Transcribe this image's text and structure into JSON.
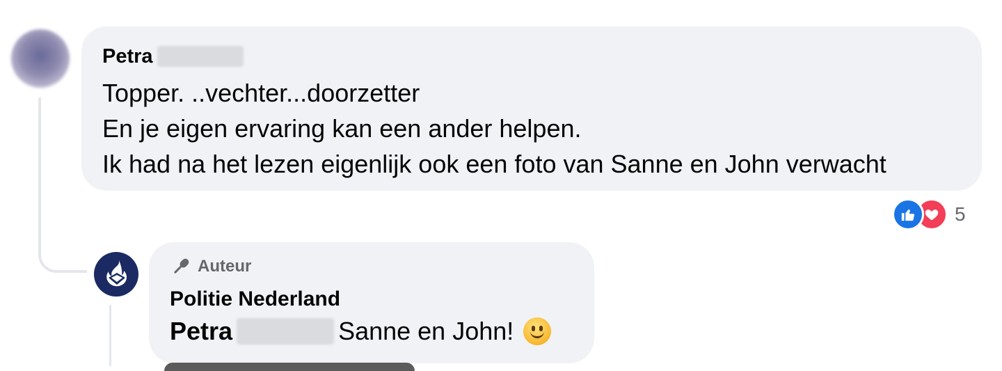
{
  "comment": {
    "author_first_name": "Petra",
    "lines": [
      "Topper. ..vechter...doorzetter",
      "En je eigen ervaring kan een ander helpen.",
      "Ik had na het lezen eigenlijk ook een foto van Sanne en John verwacht"
    ],
    "reactions": {
      "icons": [
        "like-icon",
        "love-icon"
      ],
      "count": "5",
      "colors": {
        "like": "#1b74e4",
        "love": "#f33e58"
      }
    }
  },
  "reply": {
    "badge_label": "Auteur",
    "badge_icon": "microphone-icon",
    "author": "Politie Nederland",
    "mention_first_name": "Petra",
    "text": "Sanne en John!",
    "emoji": "slightly-smiling-face"
  },
  "colors": {
    "bubble": "#f0f2f5",
    "police_avatar": "#1b2a63",
    "secondary_text": "#65676b"
  }
}
